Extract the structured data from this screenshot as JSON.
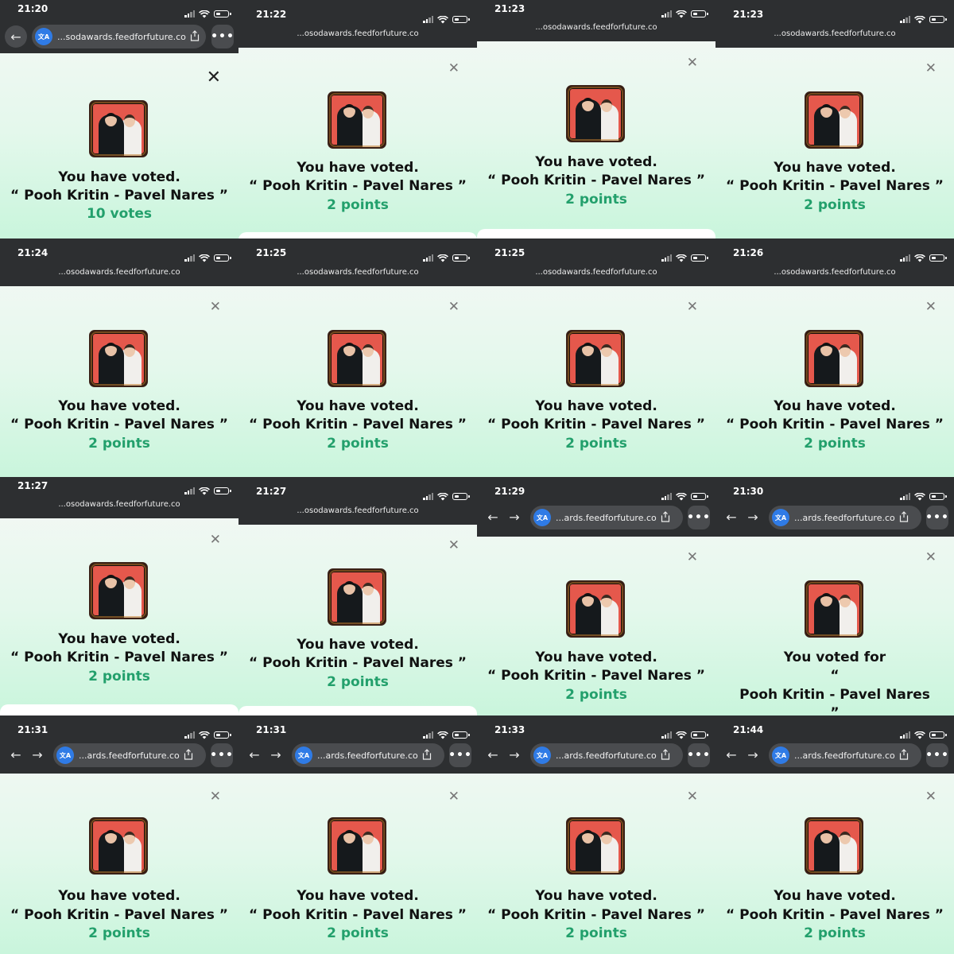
{
  "colors": {
    "status_bar": "#2d2f31",
    "accent_green": "#23a06c",
    "text": "#111111",
    "translate_badge": "#2f7be6"
  },
  "tiles": [
    {
      "time": "21:20",
      "url": "...sodawards.feedforfuture.co",
      "browser": "nav-back",
      "voted": "You have voted.",
      "nominee": "“ Pooh Kritin - Pavel Nares ”",
      "result": "10 votes"
    },
    {
      "time": "21:22",
      "url": "...osodawards.feedforfuture.co",
      "browser": "plain",
      "voted": "You have voted.",
      "nominee": "“ Pooh Kritin - Pavel Nares ”",
      "result": "2 points"
    },
    {
      "time": "21:23",
      "url": "...osodawards.feedforfuture.co",
      "browser": "plain",
      "voted": "You have voted.",
      "nominee": "“ Pooh Kritin - Pavel Nares ”",
      "result": "2 points"
    },
    {
      "time": "21:23",
      "url": "...osodawards.feedforfuture.co",
      "browser": "plain",
      "voted": "You have voted.",
      "nominee": "“ Pooh Kritin - Pavel Nares ”",
      "result": "2 points"
    },
    {
      "time": "21:24",
      "url": "...osodawards.feedforfuture.co",
      "browser": "plain",
      "voted": "You have voted.",
      "nominee": "“ Pooh Kritin - Pavel Nares ”",
      "result": "2 points"
    },
    {
      "time": "21:25",
      "url": "...osodawards.feedforfuture.co",
      "browser": "plain",
      "voted": "You have voted.",
      "nominee": "“ Pooh Kritin - Pavel Nares ”",
      "result": "2 points"
    },
    {
      "time": "21:25",
      "url": "...osodawards.feedforfuture.co",
      "browser": "plain",
      "voted": "You have voted.",
      "nominee": "“ Pooh Kritin - Pavel Nares ”",
      "result": "2 points"
    },
    {
      "time": "21:26",
      "url": "...osodawards.feedforfuture.co",
      "browser": "plain",
      "voted": "You have voted.",
      "nominee": "“ Pooh Kritin - Pavel Nares ”",
      "result": "2 points"
    },
    {
      "time": "21:27",
      "url": "...osodawards.feedforfuture.co",
      "browser": "plain",
      "voted": "You have voted.",
      "nominee": "“ Pooh Kritin - Pavel Nares ”",
      "result": "2 points"
    },
    {
      "time": "21:27",
      "url": "...osodawards.feedforfuture.co",
      "browser": "plain",
      "voted": "You have voted.",
      "nominee": "“ Pooh Kritin - Pavel Nares ”",
      "result": "2 points"
    },
    {
      "time": "21:29",
      "url": "...ards.feedforfuture.co",
      "browser": "nav-full",
      "voted": "You have voted.",
      "nominee": "“ Pooh Kritin - Pavel Nares ”",
      "result": "2 points"
    },
    {
      "time": "21:30",
      "url": "...ards.feedforfuture.co",
      "browser": "nav-full",
      "voted": "You voted for",
      "nominee": "“",
      "result": "Pooh Kritin - Pavel Nares",
      "extra": "”"
    },
    {
      "time": "21:31",
      "url": "...ards.feedforfuture.co",
      "browser": "nav-full",
      "voted": "You have voted.",
      "nominee": "“ Pooh Kritin - Pavel Nares ”",
      "result": "2 points"
    },
    {
      "time": "21:31",
      "url": "...ards.feedforfuture.co",
      "browser": "nav-full",
      "voted": "You have voted.",
      "nominee": "“ Pooh Kritin - Pavel Nares ”",
      "result": "2 points"
    },
    {
      "time": "21:33",
      "url": "...ards.feedforfuture.co",
      "browser": "nav-full",
      "voted": "You have voted.",
      "nominee": "“ Pooh Kritin - Pavel Nares ”",
      "result": "2 points"
    },
    {
      "time": "21:44",
      "url": "...ards.feedforfuture.co",
      "browser": "nav-full",
      "voted": "You have voted.",
      "nominee": "“ Pooh Kritin - Pavel Nares ”",
      "result": "2 points"
    }
  ]
}
